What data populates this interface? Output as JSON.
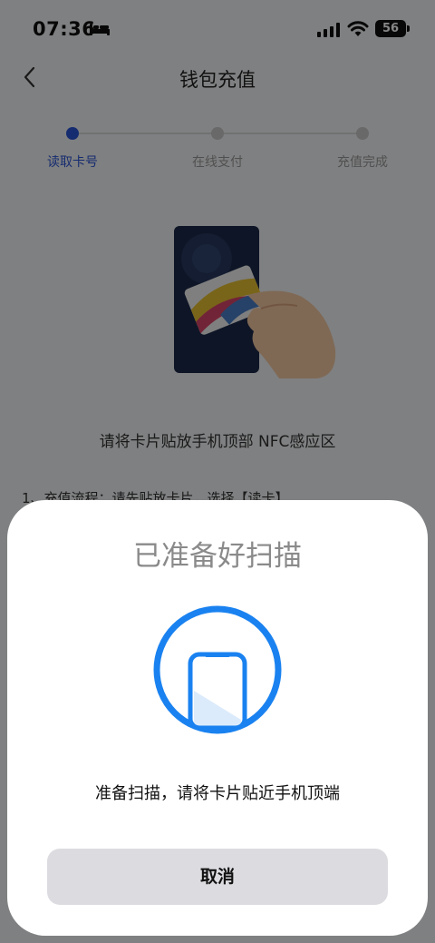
{
  "status_bar": {
    "time": "07:36",
    "battery": "56"
  },
  "nav": {
    "title": "钱包充值"
  },
  "steps": [
    {
      "label": "读取卡号",
      "active": true
    },
    {
      "label": "在线支付",
      "active": false
    },
    {
      "label": "充值完成",
      "active": false
    }
  ],
  "main": {
    "hint": "请将卡片贴放手机顶部 NFC感应区",
    "flow_text": "1、充值流程：请先贴放卡片，选择【读卡】"
  },
  "sheet": {
    "title": "已准备好扫描",
    "message": "准备扫描，请将卡片贴近手机顶端",
    "cancel_label": "取消"
  },
  "colors": {
    "accent": "#2b55d6",
    "scan_blue": "#1a82f0",
    "button_bg": "#dcdbe0"
  }
}
